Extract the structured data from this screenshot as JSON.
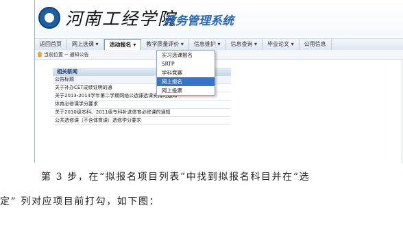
{
  "header": {
    "school_name": "河南工经学院",
    "system_title": "教务管理系统"
  },
  "menu": [
    {
      "label": "返回首页"
    },
    {
      "label": "网上选课 ▾"
    },
    {
      "label": "活动报名 ▾"
    },
    {
      "label": "教学质量评价 ▾"
    },
    {
      "label": "信息维护 ▾"
    },
    {
      "label": "信息查询 ▾"
    },
    {
      "label": "毕业论文 ▾"
    },
    {
      "label": "公用信息"
    }
  ],
  "breadcrumb": {
    "text": "当前位置 -- 通知公告"
  },
  "dropdown": {
    "items": [
      "实习选课报名",
      "SRTP",
      "学科竞赛",
      "网上报名",
      "网上投票"
    ],
    "highlighted": "网上报名"
  },
  "news": {
    "header": "相关新闻",
    "subheader": "公告标题",
    "rows": [
      "关于补办CET成绩证明的通",
      "关于2013-2014学年第二学期网络公选课选课安排的通知",
      "体育必修课学分要求",
      "关于2010级本科、2011级专科补选体育必修课的通知",
      "公共选修课（不含体育课）选修学分要求"
    ]
  },
  "caption": {
    "line1": "第 3 步，在“拟报名项目列表”中找到拟报名科目并在“选",
    "line2": "定” 列对应项目前打勾，如下图："
  }
}
